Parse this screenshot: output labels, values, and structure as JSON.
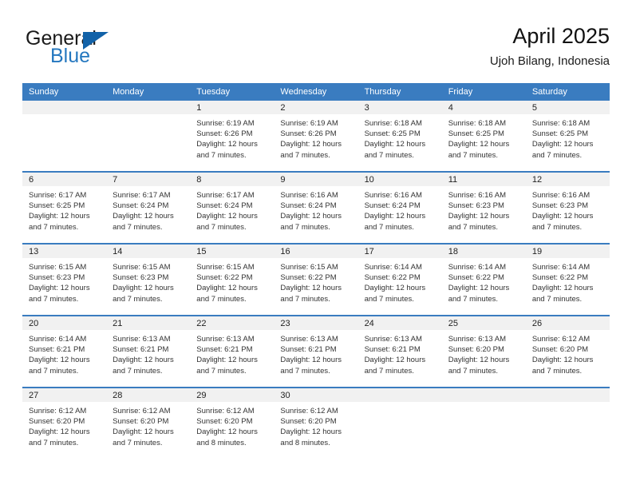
{
  "brand": {
    "name_part1": "General",
    "name_part2": "Blue",
    "triangle_icon": "triangle-icon"
  },
  "header": {
    "title": "April 2025",
    "subtitle": "Ujoh Bilang, Indonesia"
  },
  "calendar": {
    "weekday_headers": [
      "Sunday",
      "Monday",
      "Tuesday",
      "Wednesday",
      "Thursday",
      "Friday",
      "Saturday"
    ],
    "accent_color": "#3a7cc0",
    "daynum_band_color": "#f1f1f1",
    "weeks": [
      [
        {
          "day": "",
          "sunrise": "",
          "sunset": "",
          "daylight_1": "",
          "daylight_2": "",
          "empty": true
        },
        {
          "day": "",
          "sunrise": "",
          "sunset": "",
          "daylight_1": "",
          "daylight_2": "",
          "empty": true
        },
        {
          "day": "1",
          "sunrise": "Sunrise: 6:19 AM",
          "sunset": "Sunset: 6:26 PM",
          "daylight_1": "Daylight: 12 hours",
          "daylight_2": "and 7 minutes."
        },
        {
          "day": "2",
          "sunrise": "Sunrise: 6:19 AM",
          "sunset": "Sunset: 6:26 PM",
          "daylight_1": "Daylight: 12 hours",
          "daylight_2": "and 7 minutes."
        },
        {
          "day": "3",
          "sunrise": "Sunrise: 6:18 AM",
          "sunset": "Sunset: 6:25 PM",
          "daylight_1": "Daylight: 12 hours",
          "daylight_2": "and 7 minutes."
        },
        {
          "day": "4",
          "sunrise": "Sunrise: 6:18 AM",
          "sunset": "Sunset: 6:25 PM",
          "daylight_1": "Daylight: 12 hours",
          "daylight_2": "and 7 minutes."
        },
        {
          "day": "5",
          "sunrise": "Sunrise: 6:18 AM",
          "sunset": "Sunset: 6:25 PM",
          "daylight_1": "Daylight: 12 hours",
          "daylight_2": "and 7 minutes."
        }
      ],
      [
        {
          "day": "6",
          "sunrise": "Sunrise: 6:17 AM",
          "sunset": "Sunset: 6:25 PM",
          "daylight_1": "Daylight: 12 hours",
          "daylight_2": "and 7 minutes."
        },
        {
          "day": "7",
          "sunrise": "Sunrise: 6:17 AM",
          "sunset": "Sunset: 6:24 PM",
          "daylight_1": "Daylight: 12 hours",
          "daylight_2": "and 7 minutes."
        },
        {
          "day": "8",
          "sunrise": "Sunrise: 6:17 AM",
          "sunset": "Sunset: 6:24 PM",
          "daylight_1": "Daylight: 12 hours",
          "daylight_2": "and 7 minutes."
        },
        {
          "day": "9",
          "sunrise": "Sunrise: 6:16 AM",
          "sunset": "Sunset: 6:24 PM",
          "daylight_1": "Daylight: 12 hours",
          "daylight_2": "and 7 minutes."
        },
        {
          "day": "10",
          "sunrise": "Sunrise: 6:16 AM",
          "sunset": "Sunset: 6:24 PM",
          "daylight_1": "Daylight: 12 hours",
          "daylight_2": "and 7 minutes."
        },
        {
          "day": "11",
          "sunrise": "Sunrise: 6:16 AM",
          "sunset": "Sunset: 6:23 PM",
          "daylight_1": "Daylight: 12 hours",
          "daylight_2": "and 7 minutes."
        },
        {
          "day": "12",
          "sunrise": "Sunrise: 6:16 AM",
          "sunset": "Sunset: 6:23 PM",
          "daylight_1": "Daylight: 12 hours",
          "daylight_2": "and 7 minutes."
        }
      ],
      [
        {
          "day": "13",
          "sunrise": "Sunrise: 6:15 AM",
          "sunset": "Sunset: 6:23 PM",
          "daylight_1": "Daylight: 12 hours",
          "daylight_2": "and 7 minutes."
        },
        {
          "day": "14",
          "sunrise": "Sunrise: 6:15 AM",
          "sunset": "Sunset: 6:23 PM",
          "daylight_1": "Daylight: 12 hours",
          "daylight_2": "and 7 minutes."
        },
        {
          "day": "15",
          "sunrise": "Sunrise: 6:15 AM",
          "sunset": "Sunset: 6:22 PM",
          "daylight_1": "Daylight: 12 hours",
          "daylight_2": "and 7 minutes."
        },
        {
          "day": "16",
          "sunrise": "Sunrise: 6:15 AM",
          "sunset": "Sunset: 6:22 PM",
          "daylight_1": "Daylight: 12 hours",
          "daylight_2": "and 7 minutes."
        },
        {
          "day": "17",
          "sunrise": "Sunrise: 6:14 AM",
          "sunset": "Sunset: 6:22 PM",
          "daylight_1": "Daylight: 12 hours",
          "daylight_2": "and 7 minutes."
        },
        {
          "day": "18",
          "sunrise": "Sunrise: 6:14 AM",
          "sunset": "Sunset: 6:22 PM",
          "daylight_1": "Daylight: 12 hours",
          "daylight_2": "and 7 minutes."
        },
        {
          "day": "19",
          "sunrise": "Sunrise: 6:14 AM",
          "sunset": "Sunset: 6:22 PM",
          "daylight_1": "Daylight: 12 hours",
          "daylight_2": "and 7 minutes."
        }
      ],
      [
        {
          "day": "20",
          "sunrise": "Sunrise: 6:14 AM",
          "sunset": "Sunset: 6:21 PM",
          "daylight_1": "Daylight: 12 hours",
          "daylight_2": "and 7 minutes."
        },
        {
          "day": "21",
          "sunrise": "Sunrise: 6:13 AM",
          "sunset": "Sunset: 6:21 PM",
          "daylight_1": "Daylight: 12 hours",
          "daylight_2": "and 7 minutes."
        },
        {
          "day": "22",
          "sunrise": "Sunrise: 6:13 AM",
          "sunset": "Sunset: 6:21 PM",
          "daylight_1": "Daylight: 12 hours",
          "daylight_2": "and 7 minutes."
        },
        {
          "day": "23",
          "sunrise": "Sunrise: 6:13 AM",
          "sunset": "Sunset: 6:21 PM",
          "daylight_1": "Daylight: 12 hours",
          "daylight_2": "and 7 minutes."
        },
        {
          "day": "24",
          "sunrise": "Sunrise: 6:13 AM",
          "sunset": "Sunset: 6:21 PM",
          "daylight_1": "Daylight: 12 hours",
          "daylight_2": "and 7 minutes."
        },
        {
          "day": "25",
          "sunrise": "Sunrise: 6:13 AM",
          "sunset": "Sunset: 6:20 PM",
          "daylight_1": "Daylight: 12 hours",
          "daylight_2": "and 7 minutes."
        },
        {
          "day": "26",
          "sunrise": "Sunrise: 6:12 AM",
          "sunset": "Sunset: 6:20 PM",
          "daylight_1": "Daylight: 12 hours",
          "daylight_2": "and 7 minutes."
        }
      ],
      [
        {
          "day": "27",
          "sunrise": "Sunrise: 6:12 AM",
          "sunset": "Sunset: 6:20 PM",
          "daylight_1": "Daylight: 12 hours",
          "daylight_2": "and 7 minutes."
        },
        {
          "day": "28",
          "sunrise": "Sunrise: 6:12 AM",
          "sunset": "Sunset: 6:20 PM",
          "daylight_1": "Daylight: 12 hours",
          "daylight_2": "and 7 minutes."
        },
        {
          "day": "29",
          "sunrise": "Sunrise: 6:12 AM",
          "sunset": "Sunset: 6:20 PM",
          "daylight_1": "Daylight: 12 hours",
          "daylight_2": "and 8 minutes."
        },
        {
          "day": "30",
          "sunrise": "Sunrise: 6:12 AM",
          "sunset": "Sunset: 6:20 PM",
          "daylight_1": "Daylight: 12 hours",
          "daylight_2": "and 8 minutes."
        },
        {
          "day": "",
          "sunrise": "",
          "sunset": "",
          "daylight_1": "",
          "daylight_2": "",
          "empty": true
        },
        {
          "day": "",
          "sunrise": "",
          "sunset": "",
          "daylight_1": "",
          "daylight_2": "",
          "empty": true
        },
        {
          "day": "",
          "sunrise": "",
          "sunset": "",
          "daylight_1": "",
          "daylight_2": "",
          "empty": true
        }
      ]
    ]
  }
}
